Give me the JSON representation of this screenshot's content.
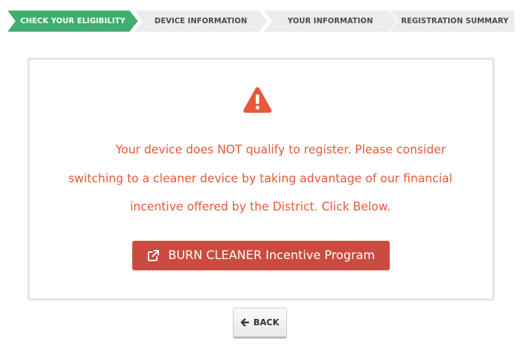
{
  "steps": [
    {
      "label": "CHECK YOUR ELIGIBILITY",
      "active": true
    },
    {
      "label": "DEVICE INFORMATION",
      "active": false
    },
    {
      "label": "YOUR INFORMATION",
      "active": false
    },
    {
      "label": "REGISTRATION SUMMARY",
      "active": false
    }
  ],
  "alert": {
    "icon": "warning-triangle-icon",
    "line1": "Your device does NOT qualify to register. Please consider",
    "line2": "switching to a cleaner device by taking advantage of our financial",
    "line3": "incentive offered by the District. Click Below."
  },
  "incentive_button": {
    "icon": "external-link-icon",
    "label": "BURN CLEANER Incentive Program"
  },
  "back_button": {
    "icon": "arrow-left-icon",
    "label": "BACK"
  },
  "colors": {
    "active_step": "#3fae6e",
    "inactive_step": "#ececec",
    "alert_text": "#e8583a",
    "incentive_button": "#cb4b40"
  }
}
